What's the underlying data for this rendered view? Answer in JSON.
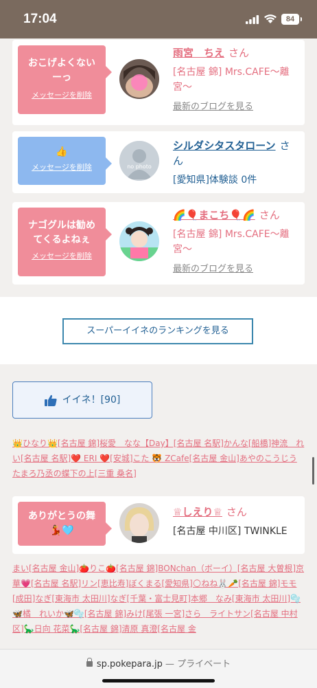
{
  "status_bar": {
    "time": "17:04",
    "battery": "84"
  },
  "cards": [
    {
      "message": "おこげよくないーっ",
      "delete_label": "メッセージを削除",
      "user_name": "雨宮　ちえ",
      "honorific": "さん",
      "shop": "[名古屋 錦] Mrs.CAFE〜離宮〜",
      "blog_link": "最新のブログを見る"
    },
    {
      "message": "👍",
      "delete_label": "メッセージを削除",
      "avatar_label": "no photo",
      "user_name": "シルダシタスタローン",
      "honorific": "さん",
      "shop": "[愛知県]体験談 0件"
    },
    {
      "message": "ナゴグルは勧めてくるよねぇ",
      "delete_label": "メッセージを削除",
      "user_name": "🌈🎈まこち🎈🌈",
      "honorific": "さん",
      "shop": "[名古屋 錦] Mrs.CAFE〜離宮〜",
      "blog_link": "最新のブログを見る"
    },
    {
      "message": "ありがとうの舞💃🩵",
      "user_name": "♕しえり♕",
      "honorific": "さん",
      "shop": "[名古屋 中川区] TWINKLE"
    }
  ],
  "ranking_button": "スーパーイイネのランキングを見る",
  "iine_button": "イイネ！[90]",
  "link_list_1": "👑ひなり👑[名古屋 錦]桜愛　なな【Day】[名古屋 名駅]かんな[船橋]神流　れい[名古屋 名駅]❤️ ERI ❤️[安城]こた 🐯 ZCafe[名古屋 金山]あやのこうじうたまろ乃丞の蝶下の上[三重 桑名]",
  "link_list_2": "まい[名古屋 金山]🍅りこ🍅[名古屋 錦]BONchan（ボーイ）[名古屋 大曽根]京華💗[名古屋 名駅]リン[恵比寿]ぼくまる[愛知県]🌕ねね🐰🥕[名古屋 錦]モモ[成田]なぎ[東海市 太田川]なぎ[千葉・富士見町]本郷　なみ[東海市 太田川]🫧🦋橘　れいか🦋🫧[名古屋 錦]みけ[尾張 一宮]さら　ライトサン[名古屋 中村区]🦕日向 花菜🦕[名古屋 錦]清原 真澄[名古屋 金",
  "url_bar": {
    "domain": "sp.pokepara.jp",
    "privacy": "— プライベート"
  },
  "colors": {
    "pink": "#f08d9a",
    "blue": "#8db8ef",
    "link": "#e46e7f",
    "navy": "#1f5e92",
    "status_bar": "#7a6a5e"
  }
}
